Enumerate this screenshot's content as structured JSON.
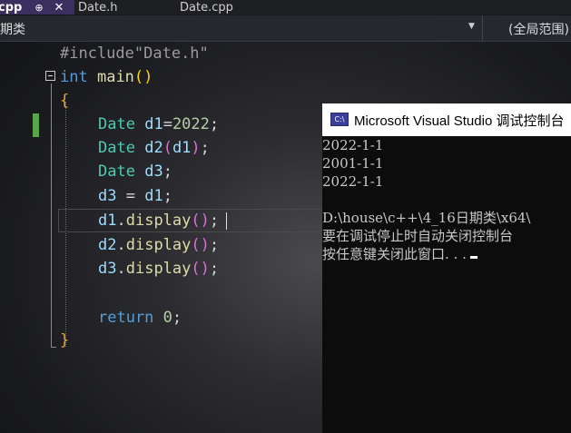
{
  "tabs": [
    {
      "label": "cpp",
      "pin": "⊕",
      "close": "✕"
    },
    {
      "label": "Date.h"
    },
    {
      "label": "Date.cpp"
    }
  ],
  "navbar": {
    "scope": "期类",
    "dropdown_icon": "chevron-down-icon",
    "global_scope": "(全局范围)"
  },
  "code": {
    "include_directive": "#include",
    "include_file": "\"Date.h\"",
    "int_kw": "int",
    "main_fn": "main",
    "type_name": "Date",
    "d1": "d1",
    "d2": "d2",
    "d3": "d3",
    "num_2022": "2022",
    "display_fn": "display",
    "return_kw": "return",
    "zero": "0"
  },
  "console": {
    "icon_label": "C:\\",
    "title": "Microsoft Visual Studio 调试控制台",
    "lines": [
      "2022-1-1",
      "2001-1-1",
      "2022-1-1",
      "",
      "D:\\house\\c++\\4_16日期类\\x64\\",
      "要在调试停止时自动关闭控制台",
      "按任意键关闭此窗口. . ."
    ]
  },
  "colors": {
    "active_tab": "#3a2f5e",
    "keyword": "#569cd6",
    "function": "#dcdcaa",
    "type": "#4ec9b0",
    "variable": "#9cdcfe",
    "number": "#b5cea8",
    "change_marker": "#57a64a"
  }
}
